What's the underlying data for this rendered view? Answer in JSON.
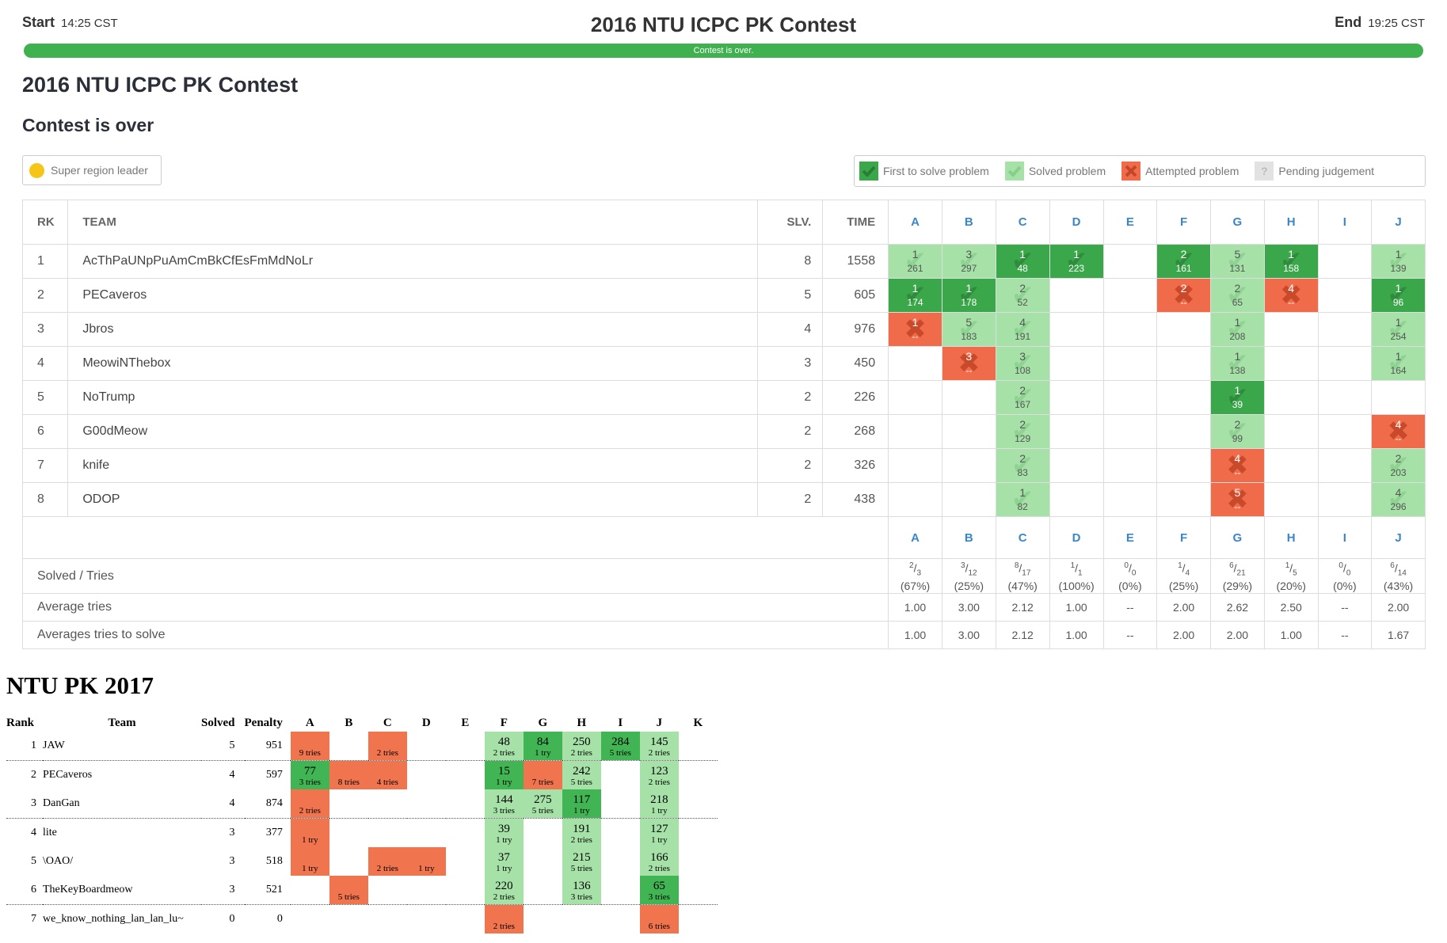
{
  "header": {
    "start_label": "Start",
    "start_time": "14:25 CST",
    "title": "2016 NTU ICPC PK Contest",
    "end_label": "End",
    "end_time": "19:25 CST",
    "progress_text": "Contest is over.",
    "progress_fraction": 1.0
  },
  "contest": {
    "title": "2016 NTU ICPC PK Contest",
    "status": "Contest is over"
  },
  "legend": {
    "region_leader": "Super region leader",
    "first_solve": "First to solve problem",
    "solved": "Solved problem",
    "attempted": "Attempted problem",
    "pending": "Pending judgement"
  },
  "colors": {
    "first": "#3aa84a",
    "solved": "#a6e2a8",
    "attempted": "#ef6b4a",
    "pending": "#dddddd",
    "progress": "#3fb24f",
    "leader": "#f5c518"
  },
  "board": {
    "headers": {
      "rank": "RK",
      "team": "TEAM",
      "solved": "SLV.",
      "time": "TIME"
    },
    "problems": [
      "A",
      "B",
      "C",
      "D",
      "E",
      "F",
      "G",
      "H",
      "I",
      "J"
    ],
    "rows": [
      {
        "rank": "1",
        "team": "AcThPaUNpPuAmCmBkCfEsFmMdNoLr",
        "solved": "8",
        "time": "1558",
        "cells": [
          {
            "s": "solved",
            "n": "1",
            "m": "261"
          },
          {
            "s": "solved",
            "n": "3",
            "m": "297"
          },
          {
            "s": "first",
            "n": "1",
            "m": "48"
          },
          {
            "s": "first",
            "n": "1",
            "m": "223"
          },
          null,
          {
            "s": "first",
            "n": "2",
            "m": "161"
          },
          {
            "s": "solved",
            "n": "5",
            "m": "131"
          },
          {
            "s": "first",
            "n": "1",
            "m": "158"
          },
          null,
          {
            "s": "solved",
            "n": "1",
            "m": "139"
          }
        ]
      },
      {
        "rank": "2",
        "team": "PECaveros",
        "solved": "5",
        "time": "605",
        "cells": [
          {
            "s": "first",
            "n": "1",
            "m": "174"
          },
          {
            "s": "first",
            "n": "1",
            "m": "178"
          },
          {
            "s": "solved",
            "n": "2",
            "m": "52"
          },
          null,
          null,
          {
            "s": "att",
            "n": "2",
            "m": "--"
          },
          {
            "s": "solved",
            "n": "2",
            "m": "65"
          },
          {
            "s": "att",
            "n": "4",
            "m": "--"
          },
          null,
          {
            "s": "first",
            "n": "1",
            "m": "96"
          }
        ]
      },
      {
        "rank": "3",
        "team": "Jbros",
        "solved": "4",
        "time": "976",
        "cells": [
          {
            "s": "att",
            "n": "1",
            "m": "--"
          },
          {
            "s": "solved",
            "n": "5",
            "m": "183"
          },
          {
            "s": "solved",
            "n": "4",
            "m": "191"
          },
          null,
          null,
          null,
          {
            "s": "solved",
            "n": "1",
            "m": "208"
          },
          null,
          null,
          {
            "s": "solved",
            "n": "1",
            "m": "254"
          }
        ]
      },
      {
        "rank": "4",
        "team": "MeowiNThebox",
        "solved": "3",
        "time": "450",
        "cells": [
          null,
          {
            "s": "att",
            "n": "3",
            "m": "--"
          },
          {
            "s": "solved",
            "n": "3",
            "m": "108"
          },
          null,
          null,
          null,
          {
            "s": "solved",
            "n": "1",
            "m": "138"
          },
          null,
          null,
          {
            "s": "solved",
            "n": "1",
            "m": "164"
          }
        ]
      },
      {
        "rank": "5",
        "team": "NoTrump",
        "solved": "2",
        "time": "226",
        "cells": [
          null,
          null,
          {
            "s": "solved",
            "n": "2",
            "m": "167"
          },
          null,
          null,
          null,
          {
            "s": "first",
            "n": "1",
            "m": "39"
          },
          null,
          null,
          null
        ]
      },
      {
        "rank": "6",
        "team": "G00dMeow",
        "solved": "2",
        "time": "268",
        "cells": [
          null,
          null,
          {
            "s": "solved",
            "n": "2",
            "m": "129"
          },
          null,
          null,
          null,
          {
            "s": "solved",
            "n": "2",
            "m": "99"
          },
          null,
          null,
          {
            "s": "att",
            "n": "4",
            "m": "--"
          }
        ]
      },
      {
        "rank": "7",
        "team": "knife",
        "solved": "2",
        "time": "326",
        "cells": [
          null,
          null,
          {
            "s": "solved",
            "n": "2",
            "m": "83"
          },
          null,
          null,
          null,
          {
            "s": "att",
            "n": "4",
            "m": "--"
          },
          null,
          null,
          {
            "s": "solved",
            "n": "2",
            "m": "203"
          }
        ]
      },
      {
        "rank": "8",
        "team": "ODOP",
        "solved": "2",
        "time": "438",
        "cells": [
          null,
          null,
          {
            "s": "solved",
            "n": "1",
            "m": "82"
          },
          null,
          null,
          null,
          {
            "s": "att",
            "n": "5",
            "m": "--"
          },
          null,
          null,
          {
            "s": "solved",
            "n": "4",
            "m": "296"
          }
        ]
      }
    ],
    "stats": {
      "solved_tries_label": "Solved / Tries",
      "avg_tries_label": "Average tries",
      "avg_solve_label": "Averages tries to solve",
      "solved_tries": [
        {
          "sol": "2",
          "tries": "3",
          "pct": "(67%)"
        },
        {
          "sol": "3",
          "tries": "12",
          "pct": "(25%)"
        },
        {
          "sol": "8",
          "tries": "17",
          "pct": "(47%)"
        },
        {
          "sol": "1",
          "tries": "1",
          "pct": "(100%)"
        },
        {
          "sol": "0",
          "tries": "0",
          "pct": "(0%)"
        },
        {
          "sol": "1",
          "tries": "4",
          "pct": "(25%)"
        },
        {
          "sol": "6",
          "tries": "21",
          "pct": "(29%)"
        },
        {
          "sol": "1",
          "tries": "5",
          "pct": "(20%)"
        },
        {
          "sol": "0",
          "tries": "0",
          "pct": "(0%)"
        },
        {
          "sol": "6",
          "tries": "14",
          "pct": "(43%)"
        }
      ],
      "avg_tries": [
        "1.00",
        "3.00",
        "2.12",
        "1.00",
        "--",
        "2.00",
        "2.62",
        "2.50",
        "--",
        "2.00"
      ],
      "avg_solve": [
        "1.00",
        "3.00",
        "2.12",
        "1.00",
        "--",
        "2.00",
        "2.00",
        "1.00",
        "--",
        "1.67"
      ]
    }
  },
  "pk2017": {
    "title": "NTU PK 2017",
    "headers": [
      "Rank",
      "Team",
      "Solved",
      "Penalty",
      "A",
      "B",
      "C",
      "D",
      "E",
      "F",
      "G",
      "H",
      "I",
      "J",
      "K"
    ],
    "rows": [
      {
        "rank": "1",
        "team": "JAW",
        "solved": "5",
        "penalty": "951",
        "sep": true,
        "cells": [
          {
            "c": "rd",
            "t": "",
            "k": "9 tries"
          },
          null,
          {
            "c": "rd",
            "t": "",
            "k": "2 tries"
          },
          null,
          null,
          {
            "c": "g2",
            "t": "48",
            "k": "2 tries"
          },
          {
            "c": "g1",
            "t": "84",
            "k": "1 try"
          },
          {
            "c": "g2",
            "t": "250",
            "k": "2 tries"
          },
          {
            "c": "g1",
            "t": "284",
            "k": "5 tries"
          },
          {
            "c": "g2",
            "t": "145",
            "k": "2 tries"
          },
          null
        ]
      },
      {
        "rank": "2",
        "team": "PECaveros",
        "solved": "4",
        "penalty": "597",
        "sep": false,
        "cells": [
          {
            "c": "g1",
            "t": "77",
            "k": "3 tries"
          },
          {
            "c": "rd",
            "t": "",
            "k": "8 tries"
          },
          {
            "c": "rd",
            "t": "",
            "k": "4 tries"
          },
          null,
          null,
          {
            "c": "g1",
            "t": "15",
            "k": "1 try"
          },
          {
            "c": "rd",
            "t": "",
            "k": "7 tries"
          },
          {
            "c": "g2",
            "t": "242",
            "k": "5 tries"
          },
          null,
          {
            "c": "g2",
            "t": "123",
            "k": "2 tries"
          },
          null
        ]
      },
      {
        "rank": "3",
        "team": "DanGan",
        "solved": "4",
        "penalty": "874",
        "sep": true,
        "cells": [
          {
            "c": "rd",
            "t": "",
            "k": "2 tries"
          },
          null,
          null,
          null,
          null,
          {
            "c": "g2",
            "t": "144",
            "k": "3 tries"
          },
          {
            "c": "g2",
            "t": "275",
            "k": "5 tries"
          },
          {
            "c": "g1",
            "t": "117",
            "k": "1 try"
          },
          null,
          {
            "c": "g2",
            "t": "218",
            "k": "1 try"
          },
          null
        ]
      },
      {
        "rank": "4",
        "team": "lite",
        "solved": "3",
        "penalty": "377",
        "sep": false,
        "cells": [
          {
            "c": "rd",
            "t": "",
            "k": "1 try"
          },
          null,
          null,
          null,
          null,
          {
            "c": "g2",
            "t": "39",
            "k": "1 try"
          },
          null,
          {
            "c": "g2",
            "t": "191",
            "k": "2 tries"
          },
          null,
          {
            "c": "g2",
            "t": "127",
            "k": "1 try"
          },
          null
        ]
      },
      {
        "rank": "5",
        "team": "\\OAO/",
        "solved": "3",
        "penalty": "518",
        "sep": false,
        "cells": [
          {
            "c": "rd",
            "t": "",
            "k": "1 try"
          },
          null,
          {
            "c": "rd",
            "t": "",
            "k": "2 tries"
          },
          {
            "c": "rd",
            "t": "",
            "k": "1 try"
          },
          null,
          {
            "c": "g2",
            "t": "37",
            "k": "1 try"
          },
          null,
          {
            "c": "g2",
            "t": "215",
            "k": "5 tries"
          },
          null,
          {
            "c": "g2",
            "t": "166",
            "k": "2 tries"
          },
          null
        ]
      },
      {
        "rank": "6",
        "team": "TheKeyBoardmeow",
        "solved": "3",
        "penalty": "521",
        "sep": true,
        "cells": [
          null,
          {
            "c": "rd",
            "t": "",
            "k": "5 tries"
          },
          null,
          null,
          null,
          {
            "c": "g2",
            "t": "220",
            "k": "2 tries"
          },
          null,
          {
            "c": "g2",
            "t": "136",
            "k": "3 tries"
          },
          null,
          {
            "c": "g1",
            "t": "65",
            "k": "3 tries"
          },
          null
        ]
      },
      {
        "rank": "7",
        "team": "we_know_nothing_lan_lan_lu~",
        "solved": "0",
        "penalty": "0",
        "sep": false,
        "cells": [
          null,
          null,
          null,
          null,
          null,
          {
            "c": "rd",
            "t": "",
            "k": "2 tries"
          },
          null,
          null,
          null,
          {
            "c": "rd",
            "t": "",
            "k": "6 tries"
          },
          null
        ]
      }
    ]
  }
}
